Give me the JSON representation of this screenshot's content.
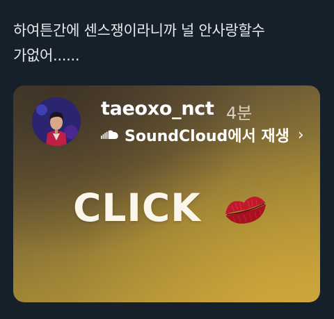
{
  "tweet": {
    "text": "하여튼간에 센스쟁이라니까 널 안사랑할수\n가없어......"
  },
  "story": {
    "username": "taeoxo_nct",
    "time_ago": "4분",
    "music_source": "SoundCloud에서 재생",
    "chevron": "›",
    "click_label": "CLICK",
    "icons": {
      "avatar": "profile-photo",
      "soundcloud": "soundcloud-icon",
      "lips": "kiss-mark-icon"
    },
    "colors": {
      "background": "#15202b",
      "text": "#e7e9ea",
      "card_gold": "#c7a43d",
      "lips_red": "#c0182c"
    }
  }
}
